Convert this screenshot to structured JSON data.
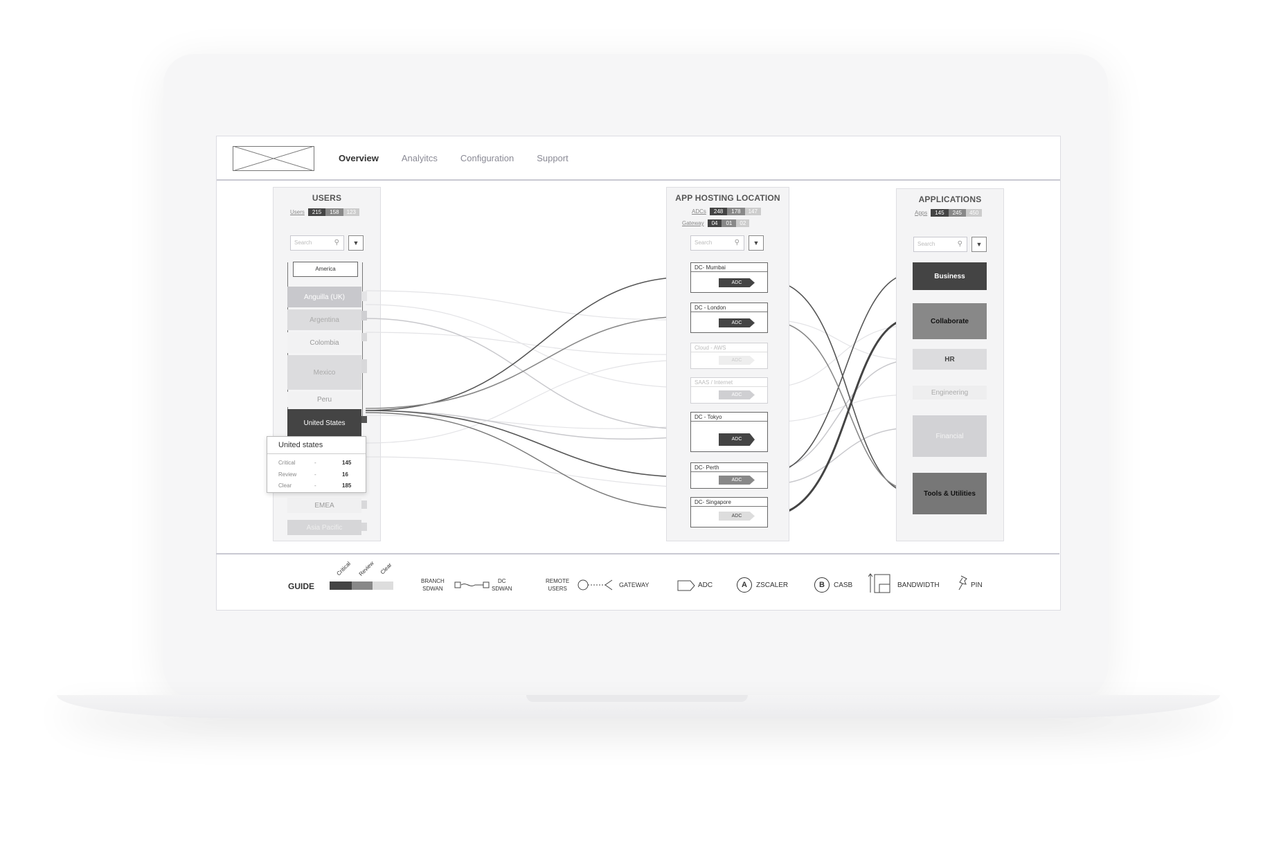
{
  "nav": {
    "items": [
      "Overview",
      "Analyitcs",
      "Configuration",
      "Support"
    ],
    "active": "Overview"
  },
  "users": {
    "title": "USERS",
    "stat_label": "Users",
    "counts": [
      "215",
      "158",
      "123"
    ],
    "search_placeholder": "Search",
    "region": "America",
    "items": [
      "Anguilla (UK)",
      "Argentina",
      "Colombia",
      "Mexico",
      "Peru",
      "United States"
    ],
    "selected": "United States",
    "other_regions": [
      "EMEA",
      "Asia Pacific"
    ],
    "tooltip": {
      "title": "United states",
      "rows": [
        {
          "label": "Critical",
          "dash": "-",
          "value": "145"
        },
        {
          "label": "Review",
          "dash": "-",
          "value": "16"
        },
        {
          "label": "Clear",
          "dash": "-",
          "value": "185"
        }
      ]
    }
  },
  "hosting": {
    "title": "APP HOSTING LOCATION",
    "adc_label": "ADCs",
    "adc_counts": [
      "248",
      "178",
      "147"
    ],
    "gateway_label": "Gateway",
    "gateway_counts": [
      "04",
      "01",
      "02"
    ],
    "search_placeholder": "Search",
    "adc_text": "ADC",
    "locations": [
      "DC- Mumbai",
      "DC - London",
      "Cloud - AWS",
      "SAAS / Internet",
      "DC - Tokyo",
      "DC- Perth",
      "DC- Singapore"
    ]
  },
  "applications": {
    "title": "APPLICATIONS",
    "stat_label": "Apps",
    "counts": [
      "145",
      "245",
      "450"
    ],
    "search_placeholder": "Search",
    "items": [
      "Business",
      "Collaborate",
      "HR",
      "Engineering",
      "Financial",
      "Tools & Utilities"
    ]
  },
  "guide": {
    "title": "GUIDE",
    "levels": [
      "Critical",
      "Review",
      "Clear"
    ],
    "branch": [
      "BRANCH",
      "SDWAN"
    ],
    "dc": [
      "DC",
      "SDWAN"
    ],
    "remote": [
      "REMOTE",
      "USERS"
    ],
    "gateway": "GATEWAY",
    "adc": "ADC",
    "zscaler_mark": "A",
    "zscaler": "ZSCALER",
    "casb_mark": "B",
    "casb": "CASB",
    "bandwidth": "BANDWIDTH",
    "pin": "PIN"
  },
  "colors": {
    "dark": "#444444",
    "mid": "#888888",
    "light": "#cccccc"
  }
}
